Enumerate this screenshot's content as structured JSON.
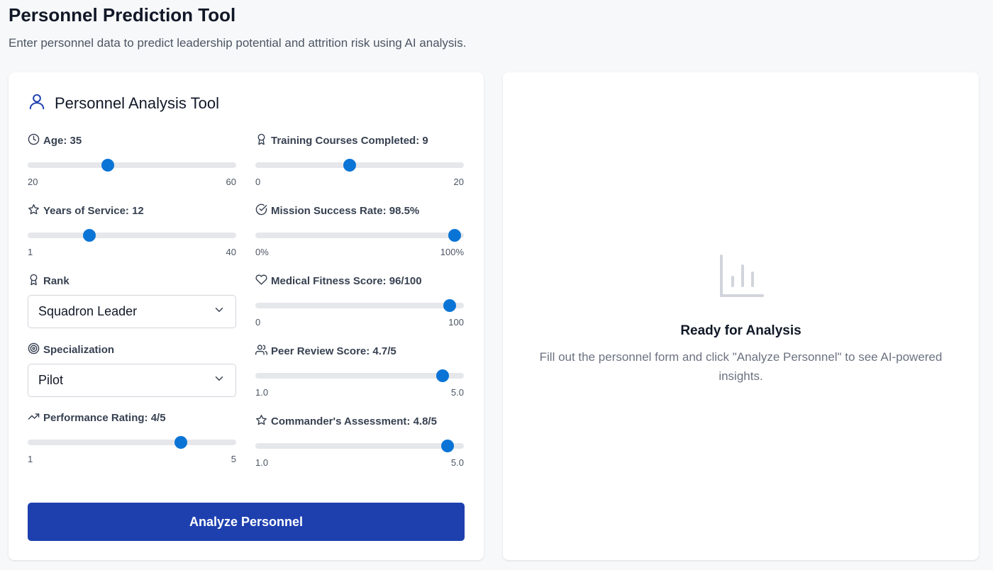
{
  "page": {
    "title": "Personnel Prediction Tool",
    "subtitle": "Enter personnel data to predict leadership potential and attrition risk using AI analysis."
  },
  "form": {
    "title": "Personnel Analysis Tool",
    "title_icon": "user-icon",
    "fields": {
      "age": {
        "label": "Age: 35",
        "icon": "clock-icon",
        "min": "20",
        "max": "60",
        "value": 35,
        "range": [
          20,
          60
        ]
      },
      "years_of_service": {
        "label": "Years of Service: 12",
        "icon": "star-icon",
        "min": "1",
        "max": "40",
        "value": 12,
        "range": [
          1,
          40
        ]
      },
      "rank": {
        "label": "Rank",
        "icon": "award-icon",
        "selected": "Squadron Leader"
      },
      "specialization": {
        "label": "Specialization",
        "icon": "target-icon",
        "selected": "Pilot"
      },
      "performance_rating": {
        "label": "Performance Rating: 4/5",
        "icon": "trending-up-icon",
        "min": "1",
        "max": "5",
        "value": 4,
        "range": [
          1,
          5
        ]
      },
      "training_courses": {
        "label": "Training Courses Completed: 9",
        "icon": "award-icon",
        "min": "0",
        "max": "20",
        "value": 9,
        "range": [
          0,
          20
        ]
      },
      "mission_success": {
        "label": "Mission Success Rate: 98.5%",
        "icon": "check-circle-icon",
        "min": "0%",
        "max": "100%",
        "value": 98.5,
        "range": [
          0,
          100
        ]
      },
      "medical_fitness": {
        "label": "Medical Fitness Score: 96/100",
        "icon": "heart-icon",
        "min": "0",
        "max": "100",
        "value": 96,
        "range": [
          0,
          100
        ]
      },
      "peer_review": {
        "label": "Peer Review Score: 4.7/5",
        "icon": "users-icon",
        "min": "1.0",
        "max": "5.0",
        "value": 4.7,
        "range": [
          1,
          5
        ]
      },
      "commander_assessment": {
        "label": "Commander's Assessment: 4.8/5",
        "icon": "star-icon",
        "min": "1.0",
        "max": "5.0",
        "value": 4.8,
        "range": [
          1,
          5
        ]
      }
    },
    "submit_label": "Analyze Personnel"
  },
  "result": {
    "icon": "bar-chart-icon",
    "title": "Ready for Analysis",
    "text": "Fill out the personnel form and click \"Analyze Personnel\" to see AI-powered insights."
  },
  "colors": {
    "accent": "#0a74d6",
    "button": "#1e40af",
    "track": "#e5e7eb"
  }
}
